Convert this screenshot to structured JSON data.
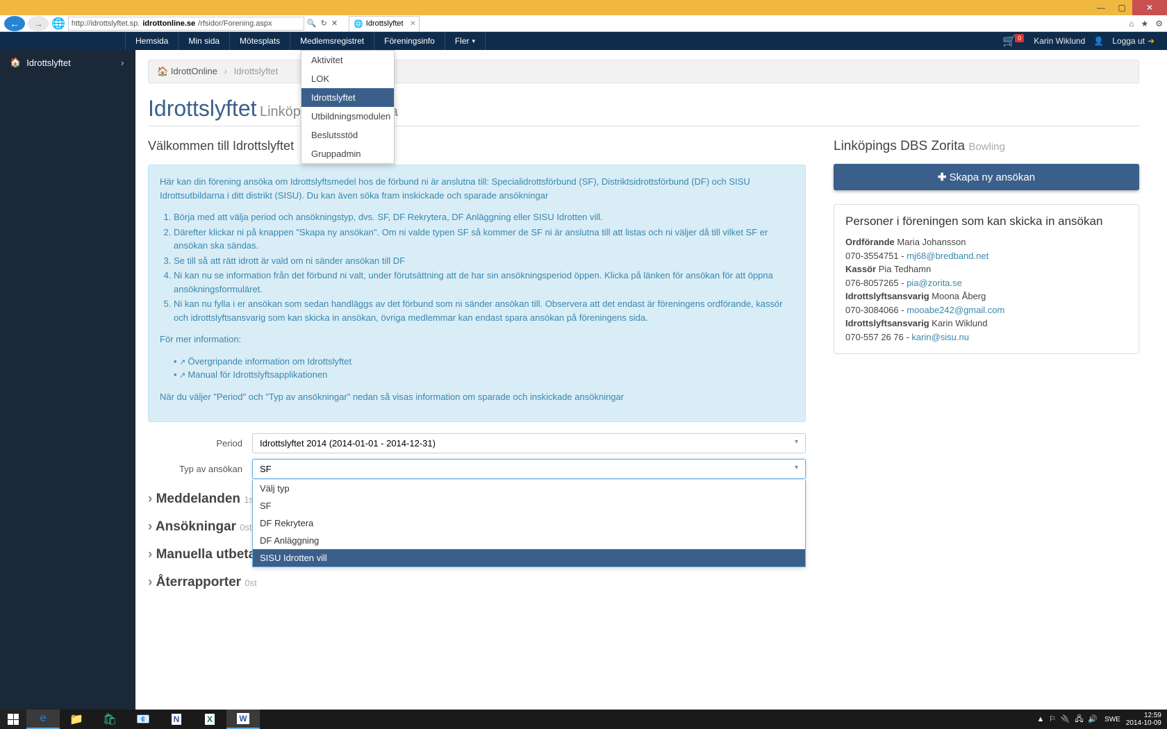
{
  "window": {
    "min": "—",
    "max": "▢",
    "close": "✕"
  },
  "chrome": {
    "url_prefix": "http://idrottslyftet.sp.",
    "url_domain": "idrottonline.se",
    "url_path": "/rfsidor/Forening.aspx",
    "tab_title": "Idrottslyftet",
    "search_icon": "🔍",
    "refresh_icon": "↻",
    "stop_icon": "✕",
    "home_icon": "⌂",
    "star_icon": "★",
    "gear_icon": "⚙"
  },
  "topnav": {
    "items": [
      "Hemsida",
      "Min sida",
      "Mötesplats",
      "Medlemsregistret",
      "Föreningsinfo",
      "Fler"
    ],
    "cart_count": "0",
    "user": "Karin Wiklund",
    "logout": "Logga ut"
  },
  "fler_menu": {
    "items": [
      "Aktivitet",
      "LOK",
      "Idrottslyftet",
      "Utbildningsmodulen",
      "Beslutsstöd",
      "Gruppadmin"
    ]
  },
  "sidebar": {
    "item": "Idrottslyftet"
  },
  "breadcrumb": {
    "home": "IdrottOnline",
    "current": "Idrottslyftet"
  },
  "title": {
    "main": "Idrottslyftet",
    "sub": "Linköpings DBS Zorita"
  },
  "welcome": {
    "heading": "Välkommen till Idrottslyftet"
  },
  "info": {
    "intro": "Här kan din förening ansöka om Idrottslyftsmedel hos de förbund ni är anslutna till: Specialidrottsförbund (SF), Distriktsidrottsförbund (DF) och SISU Idrottsutbildarna i ditt distrikt (SISU). Du kan även söka fram inskickade och sparade ansökningar",
    "steps": [
      "Börja med att välja period och ansökningstyp, dvs. SF, DF Rekrytera, DF Anläggning eller SISU Idrotten vill.",
      "Därefter klickar ni på knappen \"Skapa ny ansökan\". Om ni valde typen SF så kommer de SF ni är anslutna till att listas och ni väljer då till vilket SF er ansökan ska sändas.",
      "Se till så att rätt idrott är vald om ni sänder ansökan till DF",
      "Ni kan nu se information från det förbund ni valt, under förutsättning att de har sin ansökningsperiod öppen. Klicka på länken för ansökan för att öppna ansökningsformuläret.",
      "Ni kan nu fylla i er ansökan som sedan handläggs av det förbund som ni sänder ansökan till. Observera att det endast är föreningens ordförande, kassör och idrottslyftsansvarig som kan skicka in ansökan, övriga medlemmar kan endast spara ansökan på föreningens sida."
    ],
    "more_info": "För mer information:",
    "links": [
      "Övergripande information om Idrottslyftet",
      "Manual för Idrottslyftsapplikationen"
    ],
    "footer": "När du väljer \"Period\" och \"Typ av ansökningar\" nedan så visas information om sparade och inskickade ansökningar"
  },
  "form": {
    "period_label": "Period",
    "period_value": "Idrottslyftet 2014 (2014-01-01 - 2014-12-31)",
    "type_label": "Typ av ansökan",
    "type_value": "SF",
    "type_options": [
      "Välj typ",
      "SF",
      "DF Rekrytera",
      "DF Anläggning",
      "SISU Idrotten vill"
    ]
  },
  "sections": {
    "meddelanden": {
      "title": "Meddelanden",
      "count": "1st"
    },
    "ansokningar": {
      "title": "Ansökningar",
      "count": "0st"
    },
    "manuella": {
      "title": "Manuella utbetalningar"
    },
    "aterrapporter": {
      "title": "Återrapporter",
      "count": "0st"
    }
  },
  "right": {
    "club_name": "Linköpings DBS Zorita",
    "club_sport": "Bowling",
    "create_btn": "Skapa ny ansökan",
    "persons_heading": "Personer i föreningen som kan skicka in ansökan",
    "persons": [
      {
        "role": "Ordförande",
        "name": "Maria Johansson",
        "phone": "070-3554751",
        "email": "mj68@bredband.net"
      },
      {
        "role": "Kassör",
        "name": "Pia Tedhamn",
        "phone": "076-8057265",
        "email": "pia@zorita.se"
      },
      {
        "role": "Idrottslyftsansvarig",
        "name": "Moona Åberg",
        "phone": "070-3084066",
        "email": "mooabe242@gmail.com"
      },
      {
        "role": "Idrottslyftsansvarig",
        "name": "Karin Wiklund",
        "phone": "070-557 26 76",
        "email": "karin@sisu.nu"
      }
    ]
  },
  "taskbar": {
    "lang": "SWE",
    "time": "12:59",
    "date": "2014-10-09"
  }
}
